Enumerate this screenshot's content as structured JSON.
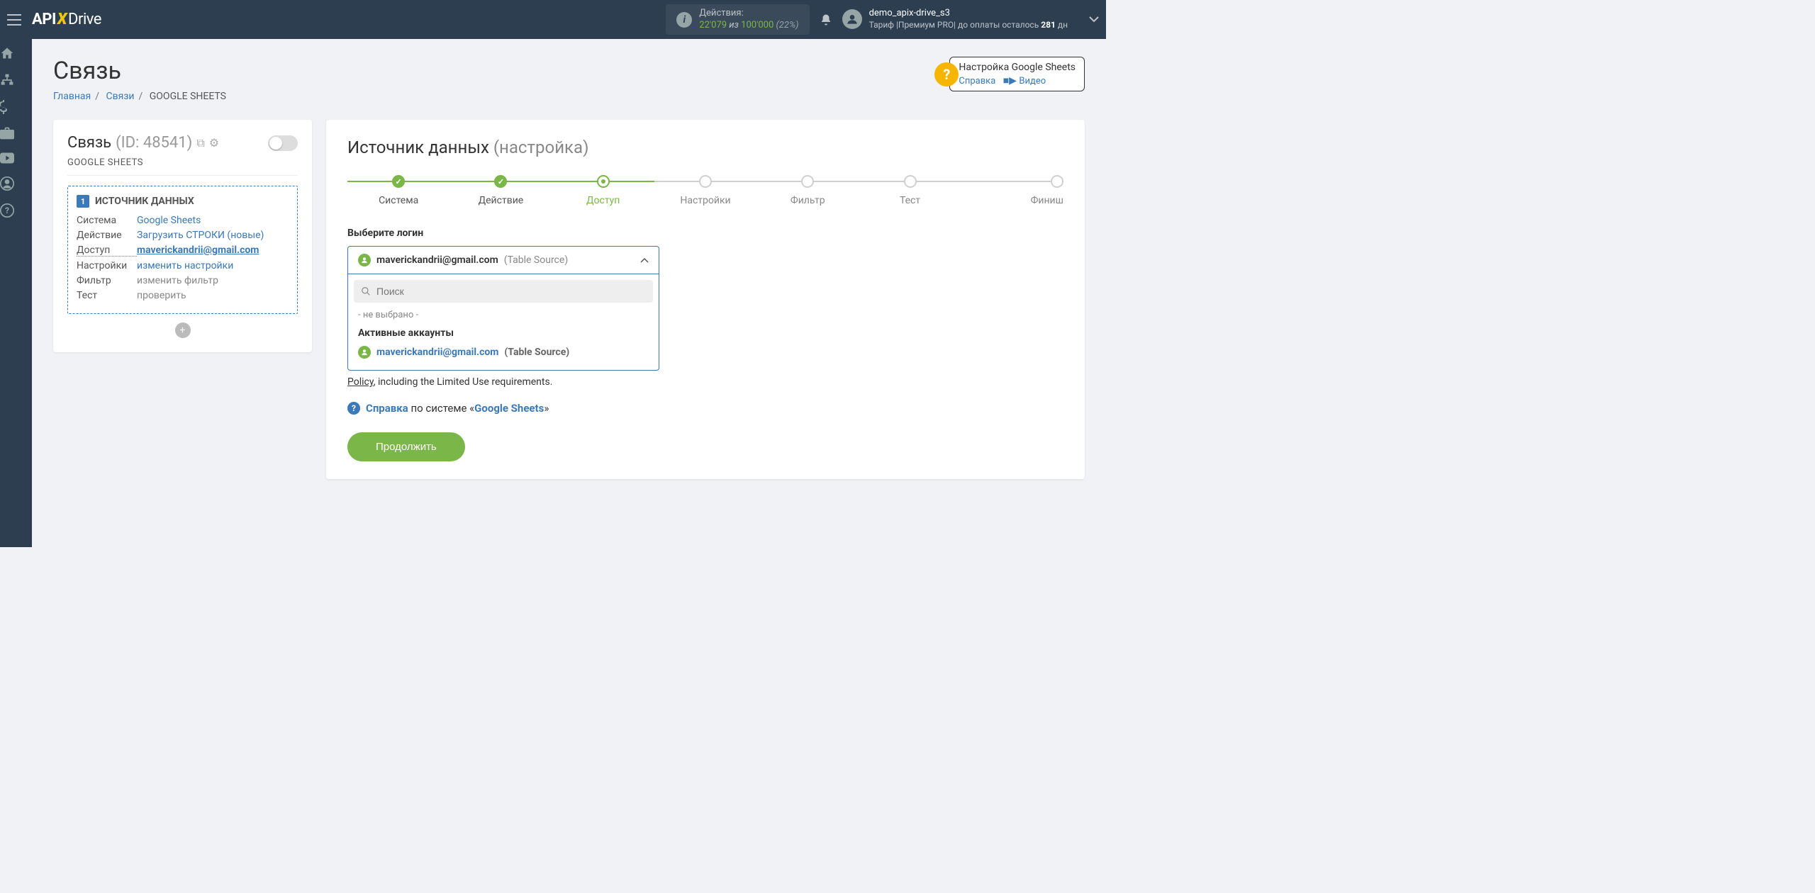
{
  "topbar": {
    "actions_label": "Действия:",
    "actions_count": "22'079",
    "actions_sep": " из ",
    "actions_total": "100'000",
    "actions_pct": " (22%)",
    "username": "demo_apix-drive_s3",
    "tariff_prefix": "Тариф |Премиум PRO| до оплаты осталось ",
    "tariff_days": "281",
    "tariff_suffix": " дн"
  },
  "page": {
    "title": "Связь",
    "bc_home": "Главная",
    "bc_links": "Связи",
    "bc_current": "GOOGLE SHEETS"
  },
  "helpbox": {
    "title": "Настройка Google Sheets",
    "ref": "Справка",
    "video": "Видео"
  },
  "leftcard": {
    "title": "Связь",
    "id": "(ID: 48541)",
    "sub": "GOOGLE SHEETS",
    "source_head": "ИСТОЧНИК ДАННЫХ",
    "rows": {
      "system_l": "Система",
      "system_v": "Google Sheets",
      "action_l": "Действие",
      "action_v": "Загрузить СТРОКИ (новые)",
      "access_l": "Доступ",
      "access_v": "maverickandrii@gmail.com",
      "settings_l": "Настройки",
      "settings_v": "изменить настройки",
      "filter_l": "Фильтр",
      "filter_v": "изменить фильтр",
      "test_l": "Тест",
      "test_v": "проверить"
    }
  },
  "rightcard": {
    "title_a": "Источник данных ",
    "title_b": "(настройка)",
    "steps": [
      "Система",
      "Действие",
      "Доступ",
      "Настройки",
      "Фильтр",
      "Тест",
      "Финиш"
    ],
    "field_label": "Выберите логин",
    "dd_email": "maverickandrii@gmail.com",
    "dd_src": "(Table Source)",
    "search_ph": "Поиск",
    "none": "- не выбрано -",
    "group": "Активные аккаунты",
    "opt_email": "maverickandrii@gmail.com",
    "opt_src": "(Table Source)",
    "policy_a": "Policy",
    "policy_b": ", including the Limited Use requirements.",
    "help_a": "Справка",
    "help_b": " по системе «",
    "help_c": "Google Sheets",
    "help_d": "»",
    "continue": "Продолжить"
  }
}
